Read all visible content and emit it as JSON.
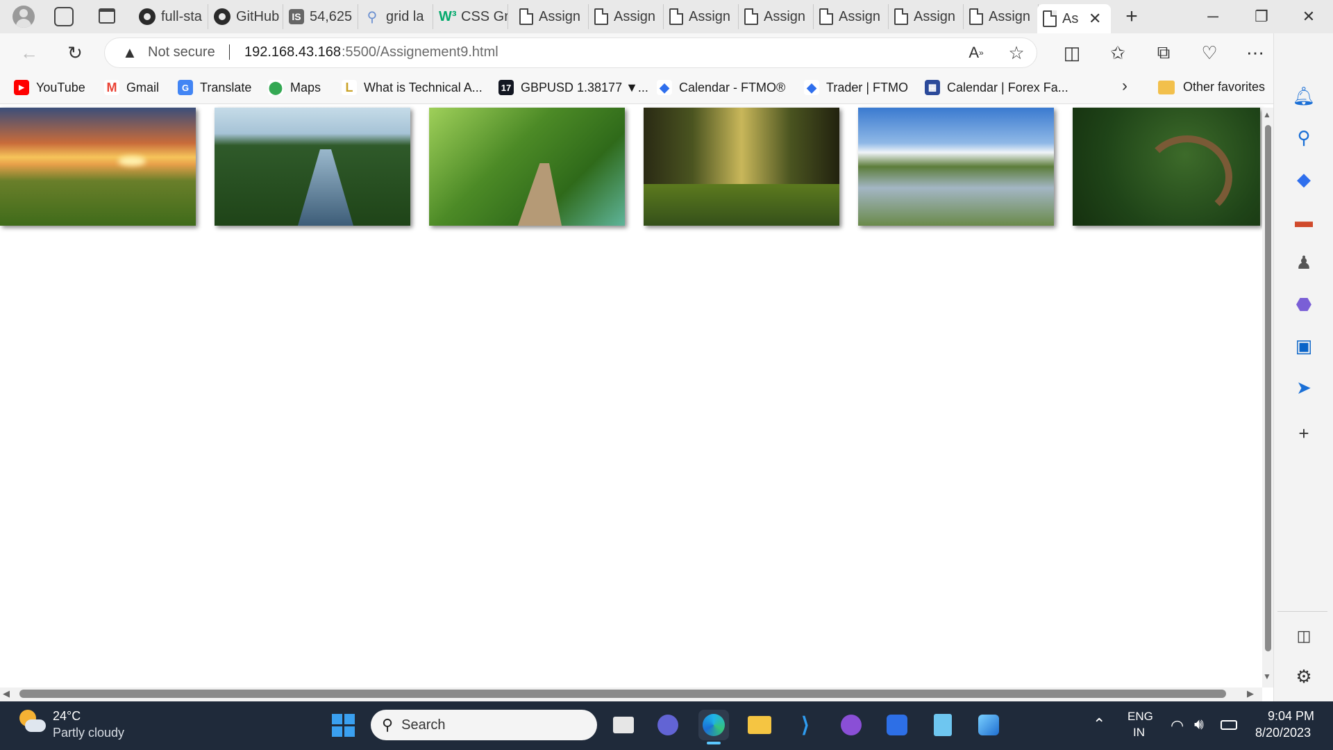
{
  "tabs": [
    {
      "label": "full-sta",
      "icon": "github-icon"
    },
    {
      "label": "GitHub",
      "icon": "github-icon"
    },
    {
      "label": "54,625",
      "icon": "is-icon"
    },
    {
      "label": "grid la",
      "icon": "search-icon"
    },
    {
      "label": "CSS Gr",
      "icon": "w3-icon"
    },
    {
      "label": "Assign",
      "icon": "file-icon"
    },
    {
      "label": "Assign",
      "icon": "file-icon"
    },
    {
      "label": "Assign",
      "icon": "file-icon"
    },
    {
      "label": "Assign",
      "icon": "file-icon"
    },
    {
      "label": "Assign",
      "icon": "file-icon"
    },
    {
      "label": "Assign",
      "icon": "file-icon"
    },
    {
      "label": "Assign",
      "icon": "file-icon"
    }
  ],
  "active_tab": {
    "label": "As"
  },
  "address": {
    "security": "Not secure",
    "host": "192.168.43.168",
    "path": ":5500/Assignement9.html"
  },
  "favorites": [
    {
      "label": "YouTube",
      "color": "#ff0000",
      "glyph": "▶"
    },
    {
      "label": "Gmail",
      "color": "#ea4335",
      "glyph": "M"
    },
    {
      "label": "Translate",
      "color": "#4285f4",
      "glyph": "G"
    },
    {
      "label": "Maps",
      "color": "#34a853",
      "glyph": "⬤"
    },
    {
      "label": "What is Technical A...",
      "color": "#c9a227",
      "glyph": "L"
    },
    {
      "label": "GBPUSD 1.38177 ▼...",
      "color": "#131722",
      "glyph": "17"
    },
    {
      "label": "Calendar - FTMO®",
      "color": "#2f6fed",
      "glyph": "◆"
    },
    {
      "label": "Trader | FTMO",
      "color": "#2f6fed",
      "glyph": "◆"
    },
    {
      "label": "Calendar | Forex Fa...",
      "color": "#2b4a9a",
      "glyph": "▦"
    }
  ],
  "other_favorites": "Other favorites",
  "gallery": [
    {
      "name": "sunset-meadow",
      "sky": "#f4a640",
      "ground": "#5f7d1c"
    },
    {
      "name": "forest-river",
      "sky": "#a9c6d9",
      "ground": "#23451e"
    },
    {
      "name": "boardwalk-path",
      "sky": "#7fb84a",
      "ground": "#3d6d1f"
    },
    {
      "name": "pine-forest",
      "sky": "#c0b15a",
      "ground": "#2f4a18"
    },
    {
      "name": "mountain-lake",
      "sky": "#5a94d8",
      "ground": "#5d7c3b"
    },
    {
      "name": "winding-river",
      "sky": "#2d5a1f",
      "ground": "#1d3d14"
    }
  ],
  "taskbar": {
    "weather_temp": "24°C",
    "weather_desc": "Partly cloudy",
    "search_placeholder": "Search",
    "lang": "ENG",
    "region": "IN",
    "time": "9:04 PM",
    "date": "8/20/2023"
  }
}
